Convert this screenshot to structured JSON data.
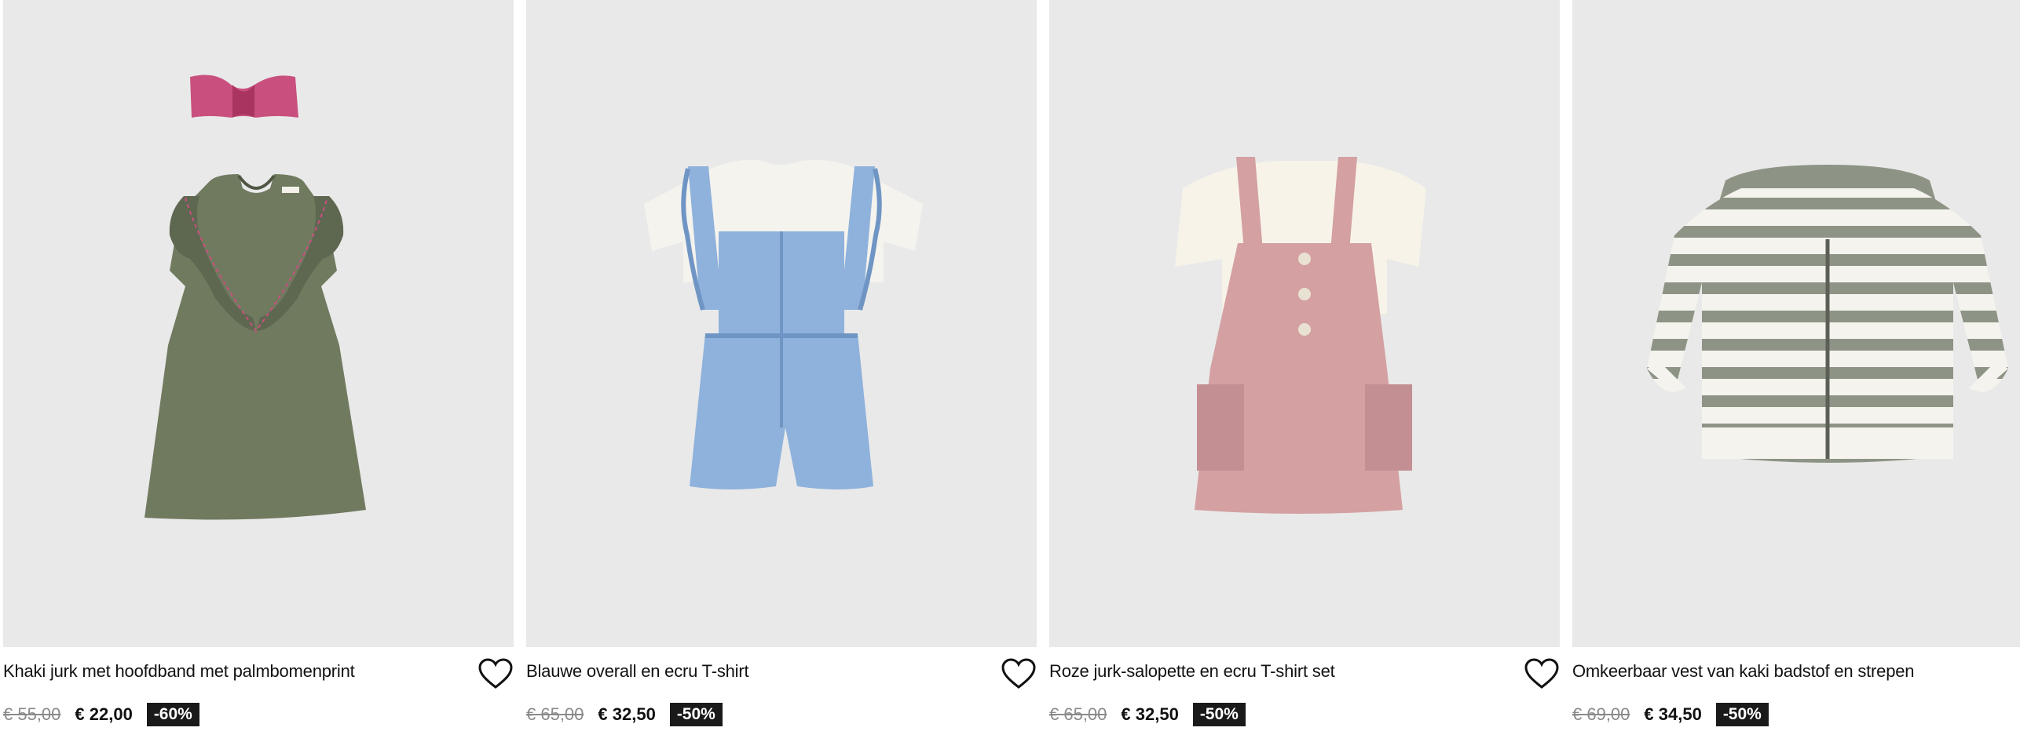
{
  "products": [
    {
      "title": "Khaki jurk met hoofdband met palmbomenprint",
      "old_price": "€ 55,00",
      "new_price": "€ 22,00",
      "discount": "-60%",
      "image_icon": "khaki-dress-with-headband",
      "colors": {
        "garment": "#707a5f",
        "accent": "#c9507e"
      }
    },
    {
      "title": "Blauwe overall en ecru T-shirt",
      "old_price": "€ 65,00",
      "new_price": "€ 32,50",
      "discount": "-50%",
      "image_icon": "blue-overall-with-tshirt",
      "colors": {
        "garment": "#8fb2dc",
        "accent": "#f5f3ee"
      }
    },
    {
      "title": "Roze jurk-salopette en ecru T-shirt set",
      "old_price": "€ 65,00",
      "new_price": "€ 32,50",
      "discount": "-50%",
      "image_icon": "pink-pinafore-with-tshirt",
      "colors": {
        "garment": "#d4a0a2",
        "accent": "#f7f3e8"
      }
    },
    {
      "title": "Omkeerbaar vest van kaki badstof en strepen",
      "old_price": "€ 69,00",
      "new_price": "€ 34,50",
      "discount": "-50%",
      "image_icon": "striped-hooded-jacket",
      "colors": {
        "garment": "#8e9485",
        "accent": "#f4f3ee"
      }
    }
  ],
  "wishlist_icon": "heart-outline-icon",
  "colors": {
    "image_bg": "#e9e9e9",
    "badge_bg": "#1a1a1a",
    "old_price": "#8a8a8a"
  }
}
